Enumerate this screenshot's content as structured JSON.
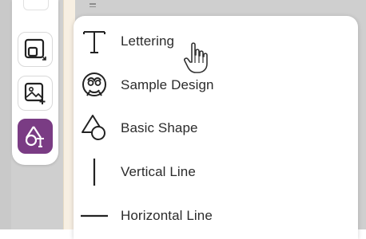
{
  "toolbar": {
    "buttons": [
      {
        "name": "top-partial-button",
        "icon": "partial-icon"
      },
      {
        "name": "shapes-group-button",
        "icon": "resize-square-icon"
      },
      {
        "name": "add-image-button",
        "icon": "image-plus-icon"
      },
      {
        "name": "text-shape-button",
        "icon": "shape-text-icon",
        "active": true
      }
    ]
  },
  "menu": {
    "items": [
      {
        "label": "Lettering",
        "icon": "lettering-T-icon"
      },
      {
        "label": "Sample Design",
        "icon": "sample-design-icon"
      },
      {
        "label": "Basic Shape",
        "icon": "basic-shape-icon"
      },
      {
        "label": "Vertical Line",
        "icon": "vertical-line-icon"
      },
      {
        "label": "Horizontal Line",
        "icon": "horizontal-line-icon"
      }
    ]
  },
  "colors": {
    "accent": "#7a3c84",
    "panel": "#ffffff",
    "background": "#cfcfcf",
    "canvas": "#f7efe2"
  }
}
